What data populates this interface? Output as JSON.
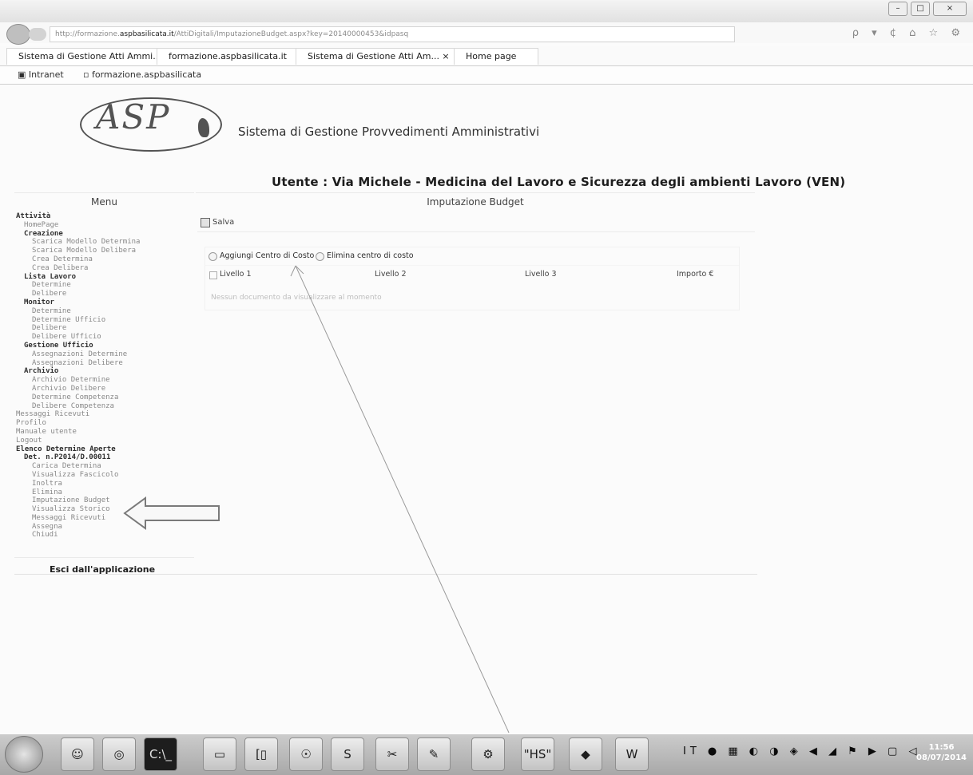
{
  "browser": {
    "url_prefix": "http://formazione.",
    "url_host": "aspbasilicata.it",
    "url_path": "/AttiDigitali/ImputazioneBudget.aspx?key=20140000453&idpasq",
    "nav_icons": "ρ ▾ ¢   ⌂ ☆ ⚙",
    "tabs": [
      {
        "label": "Sistema di Gestione Atti Ammi..."
      },
      {
        "label": "formazione.aspbasilicata.it"
      },
      {
        "label": "Sistema di Gestione Atti Am... ×"
      },
      {
        "label": "Home page"
      }
    ],
    "favorites": [
      {
        "label": "Intranet"
      },
      {
        "label": "formazione.aspbasilicata"
      }
    ],
    "window_buttons": {
      "minimize": "–",
      "maximize": "□",
      "close": "×"
    }
  },
  "header": {
    "logo_text": "ASP",
    "app_title": "Sistema di Gestione Provvedimenti Amministrativi",
    "user_line": "Utente : Via Michele - Medicina del Lavoro e Sicurezza degli ambienti Lavoro (VEN)"
  },
  "menu": {
    "header": "Menu",
    "items": [
      {
        "label": "Attività",
        "level": 0,
        "bold": true
      },
      {
        "label": "HomePage",
        "level": 1
      },
      {
        "label": "Creazione",
        "level": 1,
        "bold": true
      },
      {
        "label": "Scarica Modello Determina",
        "level": 2
      },
      {
        "label": "Scarica Modello Delibera",
        "level": 2
      },
      {
        "label": "Crea Determina",
        "level": 2
      },
      {
        "label": "Crea Delibera",
        "level": 2
      },
      {
        "label": "Lista Lavoro",
        "level": 1,
        "bold": true
      },
      {
        "label": "Determine",
        "level": 2
      },
      {
        "label": "Delibere",
        "level": 2
      },
      {
        "label": "Monitor",
        "level": 1,
        "bold": true
      },
      {
        "label": "Determine",
        "level": 2
      },
      {
        "label": "Determine Ufficio",
        "level": 2
      },
      {
        "label": "Delibere",
        "level": 2
      },
      {
        "label": "Delibere Ufficio",
        "level": 2
      },
      {
        "label": "Gestione Ufficio",
        "level": 1,
        "bold": true
      },
      {
        "label": "Assegnazioni Determine",
        "level": 2
      },
      {
        "label": "Assegnazioni Delibere",
        "level": 2
      },
      {
        "label": "Archivio",
        "level": 1,
        "bold": true
      },
      {
        "label": "Archivio Determine",
        "level": 2
      },
      {
        "label": "Archivio Delibere",
        "level": 2
      },
      {
        "label": "Determine Competenza",
        "level": 2
      },
      {
        "label": "Delibere Competenza",
        "level": 2
      },
      {
        "label": "Messaggi Ricevuti",
        "level": 0
      },
      {
        "label": "Profilo",
        "level": 0
      },
      {
        "label": "Manuale utente",
        "level": 0
      },
      {
        "label": "Logout",
        "level": 0
      },
      {
        "label": "Elenco Determine Aperte",
        "level": 0,
        "bold": true
      },
      {
        "label": "Det. n.P2014/D.00011",
        "level": 1,
        "bold": true
      },
      {
        "label": "Carica Determina",
        "level": 2
      },
      {
        "label": "Visualizza Fascicolo",
        "level": 2
      },
      {
        "label": "Inoltra",
        "level": 2
      },
      {
        "label": "Elimina",
        "level": 2
      },
      {
        "label": "Imputazione Budget",
        "level": 2
      },
      {
        "label": "Visualizza Storico",
        "level": 2
      },
      {
        "label": "Messaggi Ricevuti",
        "level": 2
      },
      {
        "label": "Assegna",
        "level": 2
      },
      {
        "label": "Chiudi",
        "level": 2
      }
    ],
    "exit_label": "Esci dall'applicazione"
  },
  "main": {
    "page_title": "Imputazione Budget",
    "save_label": "Salva",
    "add_label": "Aggiungi Centro di Costo",
    "remove_label": "Elimina centro di costo",
    "columns": [
      "Livello 1",
      "Livello 2",
      "Livello 3",
      "Importo €"
    ],
    "empty_message": "Nessun documento da visualizzare al momento"
  },
  "taskbar": {
    "apps": [
      "☺",
      "◎",
      "C:\\_",
      "▭",
      "[▯",
      "☉",
      "S",
      "✂",
      "✎",
      "⚙",
      "\"HS\"",
      "◆",
      "W"
    ],
    "tray_icons": "IT ● ▦ ◐ ◑ ◈ ◀ ◢ ⚑ ▶ ▢ ◁",
    "time": "11:56",
    "date": "08/07/2014"
  }
}
